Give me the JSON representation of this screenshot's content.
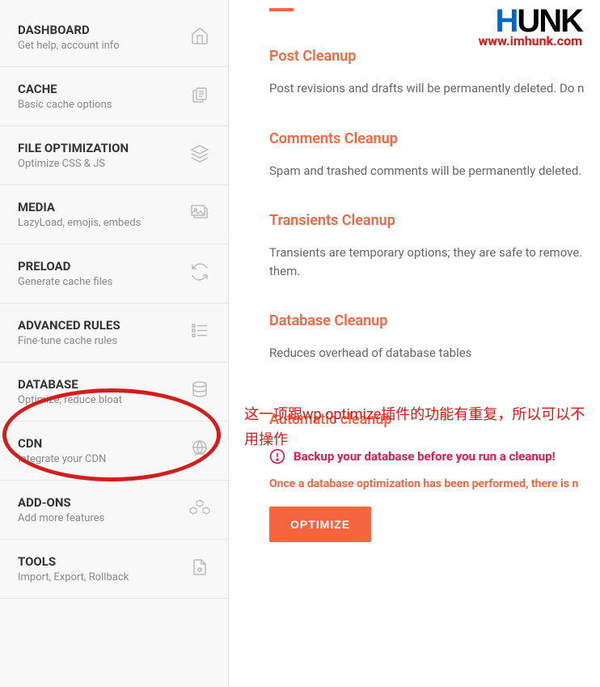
{
  "sidebar": {
    "items": [
      {
        "title": "DASHBOARD",
        "subtitle": "Get help, account info"
      },
      {
        "title": "CACHE",
        "subtitle": "Basic cache options"
      },
      {
        "title": "FILE OPTIMIZATION",
        "subtitle": "Optimize CSS & JS"
      },
      {
        "title": "MEDIA",
        "subtitle": "LazyLoad, emojis, embeds"
      },
      {
        "title": "PRELOAD",
        "subtitle": "Generate cache files"
      },
      {
        "title": "ADVANCED RULES",
        "subtitle": "Fine-tune cache rules"
      },
      {
        "title": "DATABASE",
        "subtitle": "Optimize, reduce bloat"
      },
      {
        "title": "CDN",
        "subtitle": "Integrate your CDN"
      },
      {
        "title": "ADD-ONS",
        "subtitle": "Add more features"
      },
      {
        "title": "TOOLS",
        "subtitle": "Import, Export, Rollback"
      }
    ]
  },
  "main": {
    "sections": [
      {
        "heading": "Post Cleanup",
        "desc": "Post revisions and drafts will be permanently deleted. Do n"
      },
      {
        "heading": "Comments Cleanup",
        "desc": "Spam and trashed comments will be permanently deleted."
      },
      {
        "heading": "Transients Cleanup",
        "desc": "Transients are temporary options; they are safe to remove. them."
      },
      {
        "heading": "Database Cleanup",
        "desc": "Reduces overhead of database tables"
      },
      {
        "heading": "Automatic cleanup",
        "desc": ""
      }
    ],
    "warning": "Backup your database before you run a cleanup!",
    "danger_note": "Once a database optimization has been performed, there is n",
    "optimize_label": "OPTIMIZE"
  },
  "annotation": "这一项跟wp optimize插件的功能有重复，所以可以不用操作",
  "logo": {
    "text": "HUNK",
    "url": "www.imhunk.com"
  }
}
